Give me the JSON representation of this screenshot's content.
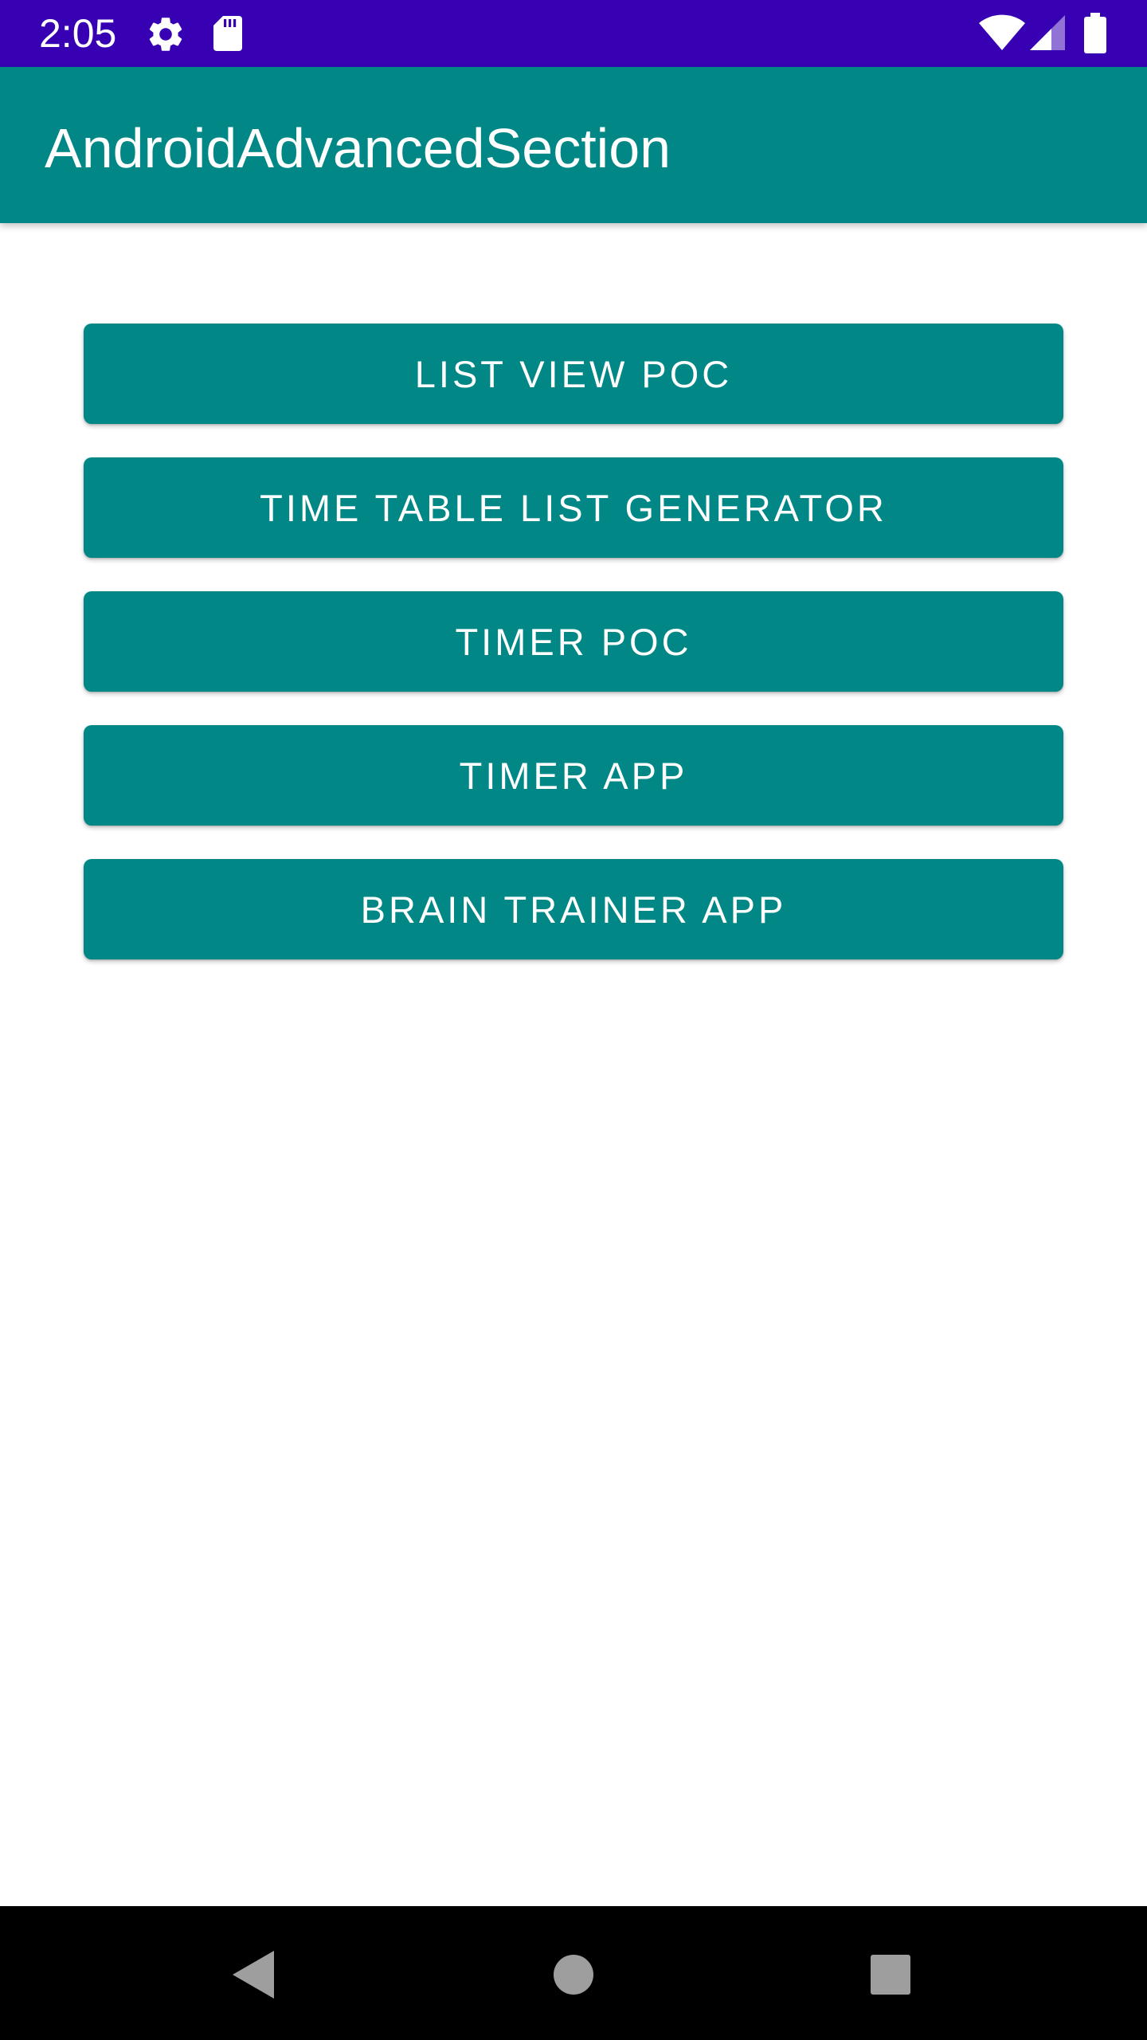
{
  "status_bar": {
    "time": "2:05",
    "background_color": "#3700b3",
    "icons": [
      "gear-icon",
      "sdcard-icon",
      "wifi-icon",
      "signal-icon",
      "battery-icon"
    ]
  },
  "app_bar": {
    "title": "AndroidAdvancedSection",
    "background_color": "#018786"
  },
  "buttons": [
    {
      "label": "LIST VIEW POC"
    },
    {
      "label": "TIME TABLE LIST GENERATOR"
    },
    {
      "label": "TIMER POC"
    },
    {
      "label": "TIMER APP"
    },
    {
      "label": "BRAIN TRAINER APP"
    }
  ],
  "nav_bar": {
    "icons": [
      "back-icon",
      "home-icon",
      "recents-icon"
    ]
  },
  "colors": {
    "primary": "#018786",
    "status_bar": "#3700b3",
    "nav_bar": "#000000",
    "nav_icons": "#9e9e9e"
  }
}
